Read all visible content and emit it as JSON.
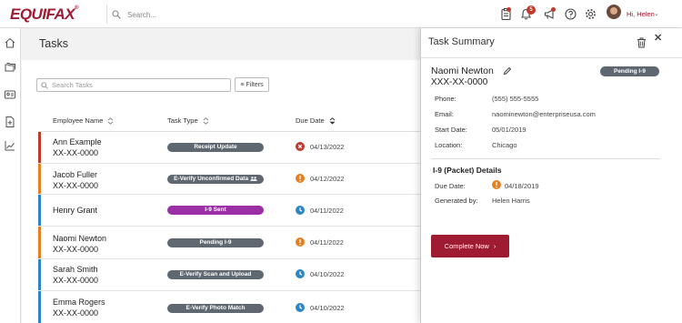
{
  "brand": {
    "logo_text": "EQUIFAX",
    "logo_mark": "®",
    "accent": "#9e1b32"
  },
  "header": {
    "search_placeholder": "Search...",
    "notifications_count": "5",
    "greeting": "Hi, Helen",
    "greeting_chevron": "⌄",
    "icons": [
      "clipboard-icon",
      "bell-icon",
      "megaphone-icon",
      "help-icon",
      "gear-icon"
    ]
  },
  "leftnav": {
    "icons": [
      "home-icon",
      "folders-icon",
      "id-card-icon",
      "document-add-icon",
      "chart-icon"
    ]
  },
  "tasks": {
    "title": "Tasks",
    "search_placeholder": "Search Tasks",
    "filters_icon": "≡",
    "filters_label": "Filters",
    "columns": [
      "Employee Name",
      "Task Type",
      "Due Date"
    ],
    "rows": [
      {
        "name": "Ann Example",
        "ssn": "XX-XX-0000",
        "task": "Receipt Update",
        "task_color": "#5f6770",
        "status": "overdue",
        "stripe": "#c0392b",
        "due": "04/13/2022"
      },
      {
        "name": "Jacob Fuller",
        "ssn": "XX-XX-0000",
        "task": "E-Verify Unconfirmed Data",
        "task_color": "#5f6770",
        "status": "warning",
        "stripe": "#e67e22",
        "due": "04/12/2022"
      },
      {
        "name": "Henry Grant",
        "ssn": "",
        "task": "I-9 Sent",
        "task_color": "#9b2fa5",
        "status": "pending",
        "stripe": "#2e86c1",
        "due": "04/11/2022"
      },
      {
        "name": "Naomi Newton",
        "ssn": "XX-XX-0000",
        "task": "Pending I-9",
        "task_color": "#5f6770",
        "status": "warning",
        "stripe": "#e67e22",
        "due": "04/11/2022"
      },
      {
        "name": "Sarah Smith",
        "ssn": "XX-XX-0000",
        "task": "E-Verify Scan and Upload",
        "task_color": "#5f6770",
        "status": "pending",
        "stripe": "#2e86c1",
        "due": "04/10/2022"
      },
      {
        "name": "Emma Rogers",
        "ssn": "XX-XX-0000",
        "task": "E-Verify Photo Match",
        "task_color": "#5f6770",
        "status": "pending",
        "stripe": "#2e86c1",
        "due": "04/10/2022"
      }
    ]
  },
  "summary": {
    "title": "Task Summary",
    "close_label": "✕",
    "name": "Naomi Newton",
    "ssn": "XXX-XX-0000",
    "badge": "Pending I-9",
    "phone_label": "Phone:",
    "phone": "(555) 555-5555",
    "email_label": "Email:",
    "email": "naominewton@enterpriseusa.com",
    "start_label": "Start Date:",
    "start": "05/01/2019",
    "location_label": "Location:",
    "location": "Chicago",
    "section_title": "I-9 (Packet) Details",
    "due_label": "Due Date:",
    "due": "04/18/2019",
    "generated_label": "Generated by:",
    "generated": "Helen Harris",
    "button_label": "Complete Now",
    "button_chevron": "›"
  }
}
